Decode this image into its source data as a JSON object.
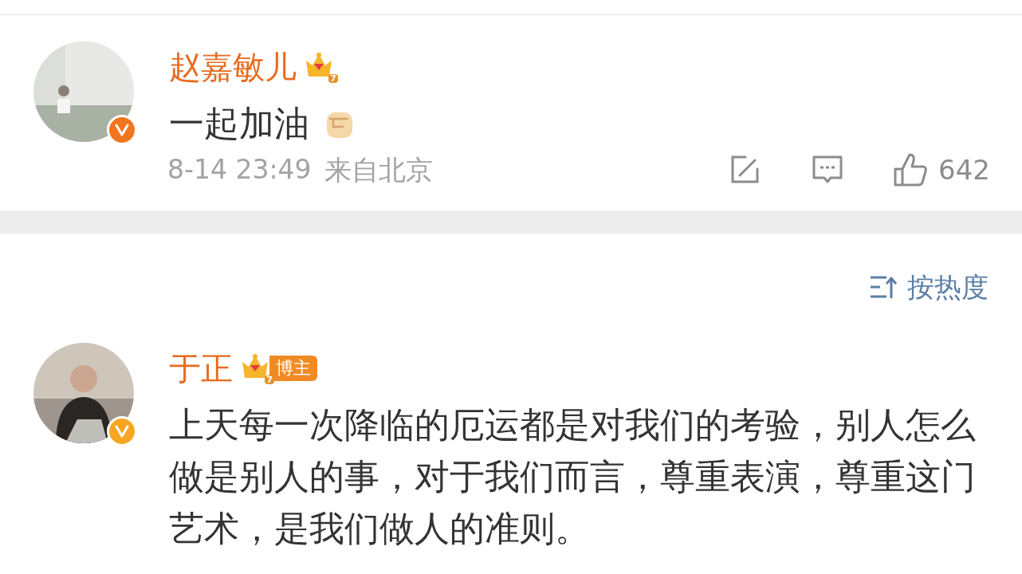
{
  "comments": [
    {
      "name": "赵嘉敏儿",
      "level": "7",
      "verified": {
        "color": "#f0751e"
      },
      "text": "一起加油",
      "emoji": true,
      "time": "8-14 23:49",
      "location": "来自北京",
      "likes": "642"
    },
    {
      "name": "于正",
      "level": "7",
      "tag": "博主",
      "verified": {
        "color": "#f5a623"
      },
      "text": "上天每一次降临的厄运都是对我们的考验，别人怎么做是别人的事，对于我们而言，尊重表演，尊重这门艺术，是我们做人的准则。",
      "emoji": false
    }
  ],
  "sort": {
    "label": "按热度"
  }
}
